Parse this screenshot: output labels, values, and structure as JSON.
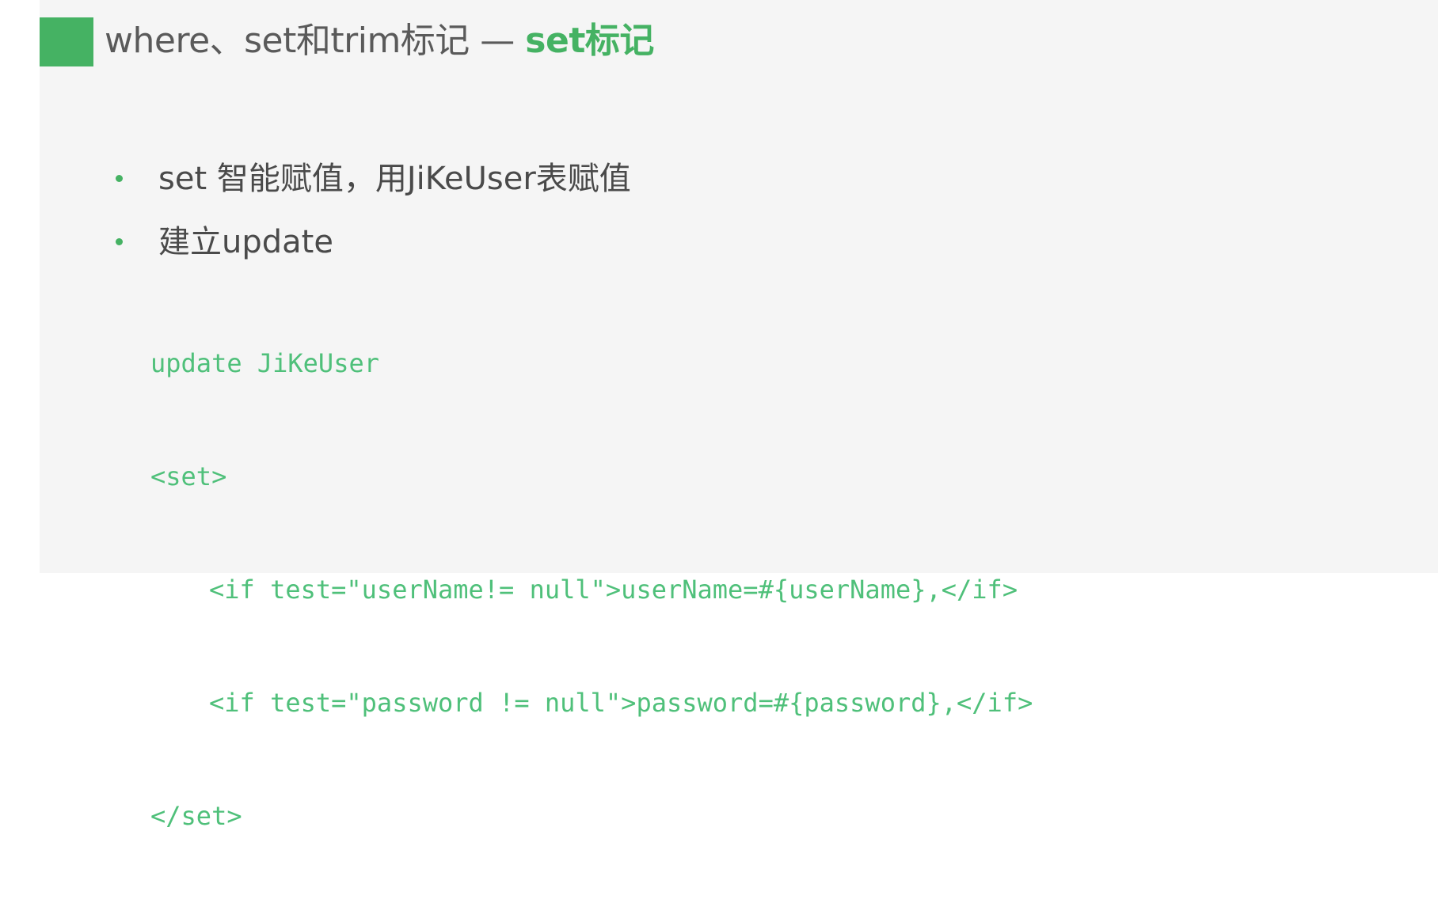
{
  "slide": {
    "title": {
      "main": "where、set和trim标记 — ",
      "accent": "set标记"
    },
    "bullets": [
      "set 智能赋值，用JiKeUser表赋值",
      "建立update"
    ],
    "code_lines": [
      "update JiKeUser",
      "<set>",
      "<if test=\"userName!= null\">userName=#{userName},</if>",
      "<if test=\"password != null\">password=#{password},</if>",
      "</set>"
    ]
  },
  "colors": {
    "accent": "#45b263",
    "code": "#4fc07a",
    "text": "#4a4a4a",
    "background": "#f5f5f5"
  }
}
